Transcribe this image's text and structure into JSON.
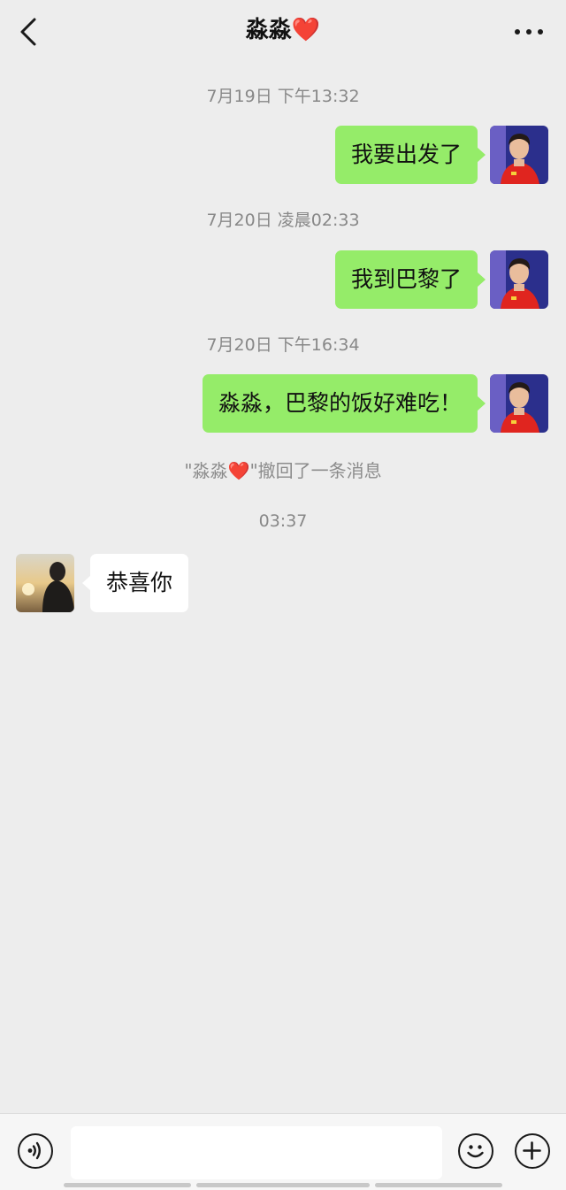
{
  "header": {
    "title": "淼淼",
    "title_emoji": "❤️",
    "back_icon": "chevron-left-icon",
    "more_icon": "more-dots-icon"
  },
  "messages": [
    {
      "type": "time",
      "text": "7月19日 下午13:32"
    },
    {
      "type": "out",
      "text": "我要出发了"
    },
    {
      "type": "time",
      "text": "7月20日 凌晨02:33"
    },
    {
      "type": "out",
      "text": "我到巴黎了"
    },
    {
      "type": "time",
      "text": "7月20日 下午16:34"
    },
    {
      "type": "out",
      "text": "淼淼，巴黎的饭好难吃！"
    },
    {
      "type": "recall",
      "name": "\"淼淼",
      "heart": "❤️",
      "text": "\"撤回了一条消息"
    },
    {
      "type": "time",
      "text": "03:37"
    },
    {
      "type": "in",
      "text": "恭喜你"
    }
  ],
  "colors": {
    "background": "#ededed",
    "outgoing_bubble": "#95ec69",
    "incoming_bubble": "#ffffff",
    "heart": "#e0142c"
  },
  "input_bar": {
    "placeholder": "",
    "voice_icon": "voice-icon",
    "emoji_icon": "emoji-icon",
    "plus_icon": "plus-icon"
  }
}
